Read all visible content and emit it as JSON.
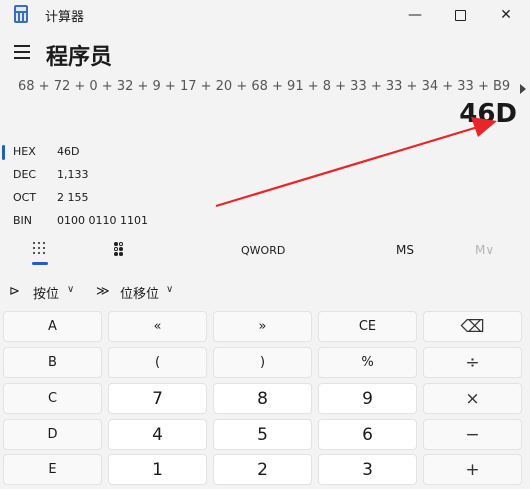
{
  "window": {
    "title": "计算器",
    "minimize_glyph": "—",
    "close_glyph": "✕"
  },
  "header": {
    "mode_title": "程序员",
    "menu_icon": "hamburger-icon"
  },
  "display": {
    "expression": "68 + 72 + 0 + 32 + 9 + 17 + 20 + 68 + 91 + 8 + 33 + 33 + 34 + 33 + B9 + 34 + 33 + 34",
    "result": "46D"
  },
  "radix": [
    {
      "name": "HEX",
      "value": "46D",
      "active": true
    },
    {
      "name": "DEC",
      "value": "1,133",
      "active": false
    },
    {
      "name": "OCT",
      "value": "2 155",
      "active": false
    },
    {
      "name": "BIN",
      "value": "0100 0110 1101",
      "active": false
    }
  ],
  "tabs": {
    "keypad_icon": "full-keypad-icon",
    "bits_icon": "bit-toggling-keypad-icon",
    "word_size": "QWORD",
    "memory_store": "MS",
    "memory_view": "M∨"
  },
  "bitops": {
    "bitwise_icon": "⊳",
    "bitwise_label": "按位",
    "shift_icon": "≫",
    "shift_label": "位移位",
    "chevron": "∨"
  },
  "keys": [
    [
      "A",
      "«",
      "»",
      "CE",
      "⌫"
    ],
    [
      "B",
      "(",
      ")",
      "%",
      "÷"
    ],
    [
      "C",
      "7",
      "8",
      "9",
      "×"
    ],
    [
      "D",
      "4",
      "5",
      "6",
      "−"
    ],
    [
      "E",
      "1",
      "2",
      "3",
      "+"
    ]
  ],
  "colors": {
    "accent": "#1f5fbf",
    "annotation_arrow": "#e8262a",
    "background": "#f3f3f3"
  }
}
